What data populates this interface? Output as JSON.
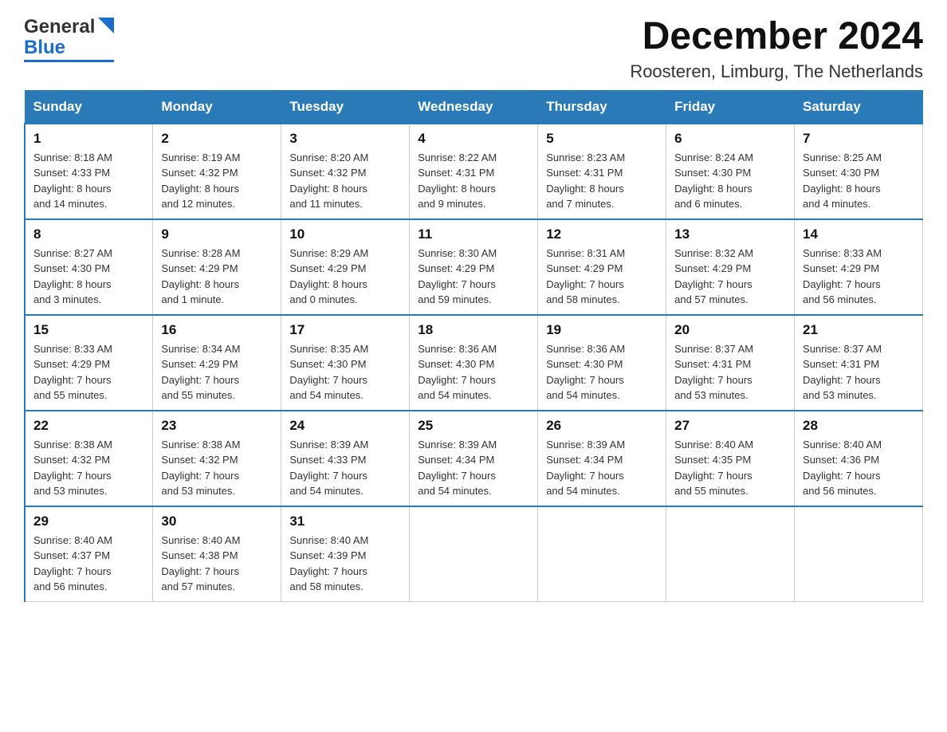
{
  "header": {
    "month_title": "December 2024",
    "location": "Roosteren, Limburg, The Netherlands",
    "logo_general": "General",
    "logo_blue": "Blue"
  },
  "weekdays": [
    "Sunday",
    "Monday",
    "Tuesday",
    "Wednesday",
    "Thursday",
    "Friday",
    "Saturday"
  ],
  "weeks": [
    [
      {
        "day": "1",
        "sunrise": "Sunrise: 8:18 AM",
        "sunset": "Sunset: 4:33 PM",
        "daylight": "Daylight: 8 hours",
        "daylight2": "and 14 minutes."
      },
      {
        "day": "2",
        "sunrise": "Sunrise: 8:19 AM",
        "sunset": "Sunset: 4:32 PM",
        "daylight": "Daylight: 8 hours",
        "daylight2": "and 12 minutes."
      },
      {
        "day": "3",
        "sunrise": "Sunrise: 8:20 AM",
        "sunset": "Sunset: 4:32 PM",
        "daylight": "Daylight: 8 hours",
        "daylight2": "and 11 minutes."
      },
      {
        "day": "4",
        "sunrise": "Sunrise: 8:22 AM",
        "sunset": "Sunset: 4:31 PM",
        "daylight": "Daylight: 8 hours",
        "daylight2": "and 9 minutes."
      },
      {
        "day": "5",
        "sunrise": "Sunrise: 8:23 AM",
        "sunset": "Sunset: 4:31 PM",
        "daylight": "Daylight: 8 hours",
        "daylight2": "and 7 minutes."
      },
      {
        "day": "6",
        "sunrise": "Sunrise: 8:24 AM",
        "sunset": "Sunset: 4:30 PM",
        "daylight": "Daylight: 8 hours",
        "daylight2": "and 6 minutes."
      },
      {
        "day": "7",
        "sunrise": "Sunrise: 8:25 AM",
        "sunset": "Sunset: 4:30 PM",
        "daylight": "Daylight: 8 hours",
        "daylight2": "and 4 minutes."
      }
    ],
    [
      {
        "day": "8",
        "sunrise": "Sunrise: 8:27 AM",
        "sunset": "Sunset: 4:30 PM",
        "daylight": "Daylight: 8 hours",
        "daylight2": "and 3 minutes."
      },
      {
        "day": "9",
        "sunrise": "Sunrise: 8:28 AM",
        "sunset": "Sunset: 4:29 PM",
        "daylight": "Daylight: 8 hours",
        "daylight2": "and 1 minute."
      },
      {
        "day": "10",
        "sunrise": "Sunrise: 8:29 AM",
        "sunset": "Sunset: 4:29 PM",
        "daylight": "Daylight: 8 hours",
        "daylight2": "and 0 minutes."
      },
      {
        "day": "11",
        "sunrise": "Sunrise: 8:30 AM",
        "sunset": "Sunset: 4:29 PM",
        "daylight": "Daylight: 7 hours",
        "daylight2": "and 59 minutes."
      },
      {
        "day": "12",
        "sunrise": "Sunrise: 8:31 AM",
        "sunset": "Sunset: 4:29 PM",
        "daylight": "Daylight: 7 hours",
        "daylight2": "and 58 minutes."
      },
      {
        "day": "13",
        "sunrise": "Sunrise: 8:32 AM",
        "sunset": "Sunset: 4:29 PM",
        "daylight": "Daylight: 7 hours",
        "daylight2": "and 57 minutes."
      },
      {
        "day": "14",
        "sunrise": "Sunrise: 8:33 AM",
        "sunset": "Sunset: 4:29 PM",
        "daylight": "Daylight: 7 hours",
        "daylight2": "and 56 minutes."
      }
    ],
    [
      {
        "day": "15",
        "sunrise": "Sunrise: 8:33 AM",
        "sunset": "Sunset: 4:29 PM",
        "daylight": "Daylight: 7 hours",
        "daylight2": "and 55 minutes."
      },
      {
        "day": "16",
        "sunrise": "Sunrise: 8:34 AM",
        "sunset": "Sunset: 4:29 PM",
        "daylight": "Daylight: 7 hours",
        "daylight2": "and 55 minutes."
      },
      {
        "day": "17",
        "sunrise": "Sunrise: 8:35 AM",
        "sunset": "Sunset: 4:30 PM",
        "daylight": "Daylight: 7 hours",
        "daylight2": "and 54 minutes."
      },
      {
        "day": "18",
        "sunrise": "Sunrise: 8:36 AM",
        "sunset": "Sunset: 4:30 PM",
        "daylight": "Daylight: 7 hours",
        "daylight2": "and 54 minutes."
      },
      {
        "day": "19",
        "sunrise": "Sunrise: 8:36 AM",
        "sunset": "Sunset: 4:30 PM",
        "daylight": "Daylight: 7 hours",
        "daylight2": "and 54 minutes."
      },
      {
        "day": "20",
        "sunrise": "Sunrise: 8:37 AM",
        "sunset": "Sunset: 4:31 PM",
        "daylight": "Daylight: 7 hours",
        "daylight2": "and 53 minutes."
      },
      {
        "day": "21",
        "sunrise": "Sunrise: 8:37 AM",
        "sunset": "Sunset: 4:31 PM",
        "daylight": "Daylight: 7 hours",
        "daylight2": "and 53 minutes."
      }
    ],
    [
      {
        "day": "22",
        "sunrise": "Sunrise: 8:38 AM",
        "sunset": "Sunset: 4:32 PM",
        "daylight": "Daylight: 7 hours",
        "daylight2": "and 53 minutes."
      },
      {
        "day": "23",
        "sunrise": "Sunrise: 8:38 AM",
        "sunset": "Sunset: 4:32 PM",
        "daylight": "Daylight: 7 hours",
        "daylight2": "and 53 minutes."
      },
      {
        "day": "24",
        "sunrise": "Sunrise: 8:39 AM",
        "sunset": "Sunset: 4:33 PM",
        "daylight": "Daylight: 7 hours",
        "daylight2": "and 54 minutes."
      },
      {
        "day": "25",
        "sunrise": "Sunrise: 8:39 AM",
        "sunset": "Sunset: 4:34 PM",
        "daylight": "Daylight: 7 hours",
        "daylight2": "and 54 minutes."
      },
      {
        "day": "26",
        "sunrise": "Sunrise: 8:39 AM",
        "sunset": "Sunset: 4:34 PM",
        "daylight": "Daylight: 7 hours",
        "daylight2": "and 54 minutes."
      },
      {
        "day": "27",
        "sunrise": "Sunrise: 8:40 AM",
        "sunset": "Sunset: 4:35 PM",
        "daylight": "Daylight: 7 hours",
        "daylight2": "and 55 minutes."
      },
      {
        "day": "28",
        "sunrise": "Sunrise: 8:40 AM",
        "sunset": "Sunset: 4:36 PM",
        "daylight": "Daylight: 7 hours",
        "daylight2": "and 56 minutes."
      }
    ],
    [
      {
        "day": "29",
        "sunrise": "Sunrise: 8:40 AM",
        "sunset": "Sunset: 4:37 PM",
        "daylight": "Daylight: 7 hours",
        "daylight2": "and 56 minutes."
      },
      {
        "day": "30",
        "sunrise": "Sunrise: 8:40 AM",
        "sunset": "Sunset: 4:38 PM",
        "daylight": "Daylight: 7 hours",
        "daylight2": "and 57 minutes."
      },
      {
        "day": "31",
        "sunrise": "Sunrise: 8:40 AM",
        "sunset": "Sunset: 4:39 PM",
        "daylight": "Daylight: 7 hours",
        "daylight2": "and 58 minutes."
      },
      {
        "day": "",
        "sunrise": "",
        "sunset": "",
        "daylight": "",
        "daylight2": ""
      },
      {
        "day": "",
        "sunrise": "",
        "sunset": "",
        "daylight": "",
        "daylight2": ""
      },
      {
        "day": "",
        "sunrise": "",
        "sunset": "",
        "daylight": "",
        "daylight2": ""
      },
      {
        "day": "",
        "sunrise": "",
        "sunset": "",
        "daylight": "",
        "daylight2": ""
      }
    ]
  ],
  "colors": {
    "header_bg": "#2a7ab8",
    "header_text": "#ffffff",
    "border": "#cccccc",
    "accent_blue": "#1a6dcc"
  }
}
